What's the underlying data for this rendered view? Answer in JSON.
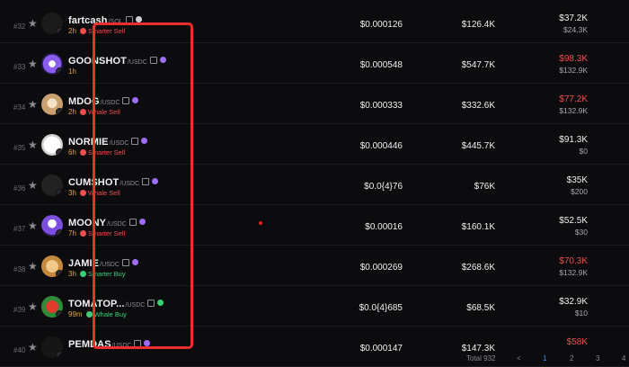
{
  "colors": {
    "sell": "#ef4f4f",
    "buy": "#3ccf7a",
    "age": "#e3a33a",
    "chain_purple": "#a06cff",
    "chain_green": "#39d06f",
    "highlight": "#ee2e2e"
  },
  "rows": [
    {
      "rank": "#32",
      "ticker": "fartcash",
      "pair": "/SOL",
      "age": "2h",
      "tag": "Smarter Sell",
      "tag_type": "sell",
      "price": "$0.000126",
      "mcap": "$126.4K",
      "vol": "$37.2K",
      "vol_color": "white",
      "vol2": "$24.3K",
      "chain": "sol"
    },
    {
      "rank": "#33",
      "ticker": "GOONSHOT",
      "pair": "/USDC",
      "age": "1h",
      "tag": "",
      "tag_type": "none",
      "price": "$0.000548",
      "mcap": "$547.7K",
      "vol": "$98.3K",
      "vol_color": "red",
      "vol2": "$132.9K",
      "chain": "purple"
    },
    {
      "rank": "#34",
      "ticker": "MDOG",
      "pair": "/USDC",
      "age": "2h",
      "tag": "Whale Sell",
      "tag_type": "sell",
      "price": "$0.000333",
      "mcap": "$332.6K",
      "vol": "$77.2K",
      "vol_color": "red",
      "vol2": "$132.9K",
      "chain": "purple"
    },
    {
      "rank": "#35",
      "ticker": "NORMIE",
      "pair": "/USDC",
      "age": "6h",
      "tag": "Smarter Sell",
      "tag_type": "sell",
      "price": "$0.000446",
      "mcap": "$445.7K",
      "vol": "$91.3K",
      "vol_color": "white",
      "vol2": "$0",
      "chain": "purple"
    },
    {
      "rank": "#36",
      "ticker": "CUMSHOT",
      "pair": "/USDC",
      "age": "3h",
      "tag": "Whale Sell",
      "tag_type": "sell",
      "price": "$0.0{4}76",
      "mcap": "$76K",
      "vol": "$35K",
      "vol_color": "white",
      "vol2": "$200",
      "chain": "purple"
    },
    {
      "rank": "#37",
      "ticker": "MOONY",
      "pair": "/USDC",
      "age": "7h",
      "tag": "Smarter Sell",
      "tag_type": "sell",
      "price": "$0.00016",
      "mcap": "$160.1K",
      "vol": "$52.5K",
      "vol_color": "white",
      "vol2": "$30",
      "chain": "purple"
    },
    {
      "rank": "#38",
      "ticker": "JAMIE",
      "pair": "/USDC",
      "age": "3h",
      "tag": "Smarter Buy",
      "tag_type": "buy",
      "price": "$0.000269",
      "mcap": "$268.6K",
      "vol": "$70.3K",
      "vol_color": "red",
      "vol2": "$132.9K",
      "chain": "purple"
    },
    {
      "rank": "#39",
      "ticker": "TOMATOP...",
      "pair": "/USDC",
      "age": "99m",
      "tag": "Whale Buy",
      "tag_type": "buy",
      "price": "$0.0{4}685",
      "mcap": "$68.5K",
      "vol": "$32.9K",
      "vol_color": "white",
      "vol2": "$10",
      "chain": "green"
    },
    {
      "rank": "#40",
      "ticker": "PEMDAS",
      "pair": "/USDC",
      "age": "",
      "tag": "",
      "tag_type": "none",
      "price": "$0.000147",
      "mcap": "$147.3K",
      "vol": "$58K",
      "vol_color": "red",
      "vol2": "",
      "chain": "purple"
    }
  ],
  "footer": {
    "total_label": "Total 932",
    "prev": "<",
    "pages": [
      "1",
      "2",
      "3",
      "4"
    ],
    "current_page": "1"
  }
}
